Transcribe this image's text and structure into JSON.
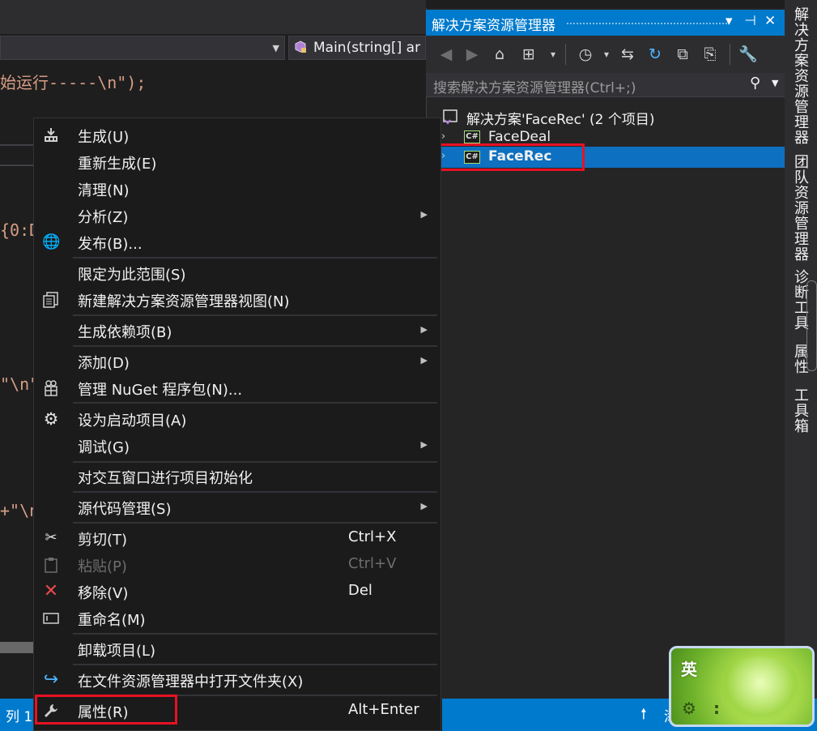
{
  "editor": {
    "method_combo": "Main(string[] ar",
    "code_lines": {
      "line1": "始运行-----\\n\");",
      "line2": "{0:D",
      "line3": "\"\\n\"",
      "line4": "+\"\\n"
    }
  },
  "solution_explorer": {
    "title": "解决方案资源管理器",
    "title_buttons": {
      "dropdown": "▾",
      "pin": "⊣",
      "close": "✕"
    },
    "search_placeholder": "搜索解决方案资源管理器(Ctrl+;)",
    "tree": {
      "solution": "解决方案'FaceRec' (2 个项目)",
      "projects": [
        "FaceDeal",
        "FaceRec"
      ],
      "project_icon": "C#",
      "selected_project": "FaceRec"
    },
    "toolbar_icons": [
      "back-icon",
      "forward-icon",
      "home-icon",
      "switch-views-icon",
      "pending-changes-icon",
      "sync-icon",
      "refresh-icon",
      "collapse-all-icon",
      "show-all-files-icon",
      "properties-icon"
    ]
  },
  "side_tabs": [
    "解决方案资源管理器",
    "团队资源管理器",
    "诊断工具",
    "属性",
    "工具箱"
  ],
  "status_bar": {
    "left_text": "列 1",
    "right_text": "添"
  },
  "context_menu": {
    "items": [
      {
        "label": "生成(U)",
        "icon": "build-icon"
      },
      {
        "label": "重新生成(E)"
      },
      {
        "label": "清理(N)"
      },
      {
        "label": "分析(Z)",
        "submenu": true
      },
      {
        "label": "发布(B)...",
        "icon": "publish-globe-icon"
      },
      {
        "label": "限定为此范围(S)"
      },
      {
        "label": "新建解决方案资源管理器视图(N)",
        "icon": "new-view-icon"
      },
      {
        "label": "生成依赖项(B)",
        "submenu": true
      },
      {
        "label": "添加(D)",
        "submenu": true
      },
      {
        "label": "管理 NuGet 程序包(N)...",
        "icon": "nuget-icon"
      },
      {
        "label": "设为启动项目(A)",
        "icon": "gear-icon"
      },
      {
        "label": "调试(G)",
        "submenu": true
      },
      {
        "label": "对交互窗口进行项目初始化"
      },
      {
        "label": "源代码管理(S)",
        "submenu": true
      },
      {
        "label": "剪切(T)",
        "shortcut": "Ctrl+X",
        "icon": "scissors-icon"
      },
      {
        "label": "粘贴(P)",
        "shortcut": "Ctrl+V",
        "icon": "paste-icon",
        "disabled": true
      },
      {
        "label": "移除(V)",
        "shortcut": "Del",
        "icon": "remove-x-icon"
      },
      {
        "label": "重命名(M)",
        "icon": "rename-icon"
      },
      {
        "label": "卸载项目(L)"
      },
      {
        "label": "在文件资源管理器中打开文件夹(X)",
        "icon": "open-folder-arrow-icon"
      },
      {
        "label": "属性(R)",
        "shortcut": "Alt+Enter",
        "icon": "wrench-icon",
        "highlighted": true
      }
    ],
    "submenu_arrow": "▶"
  },
  "ime": {
    "mode": "英"
  },
  "colors": {
    "accent": "#007acc",
    "highlight_box": "#e81123",
    "menu_bg": "#1b1b1c",
    "selection": "#0e70c0"
  }
}
